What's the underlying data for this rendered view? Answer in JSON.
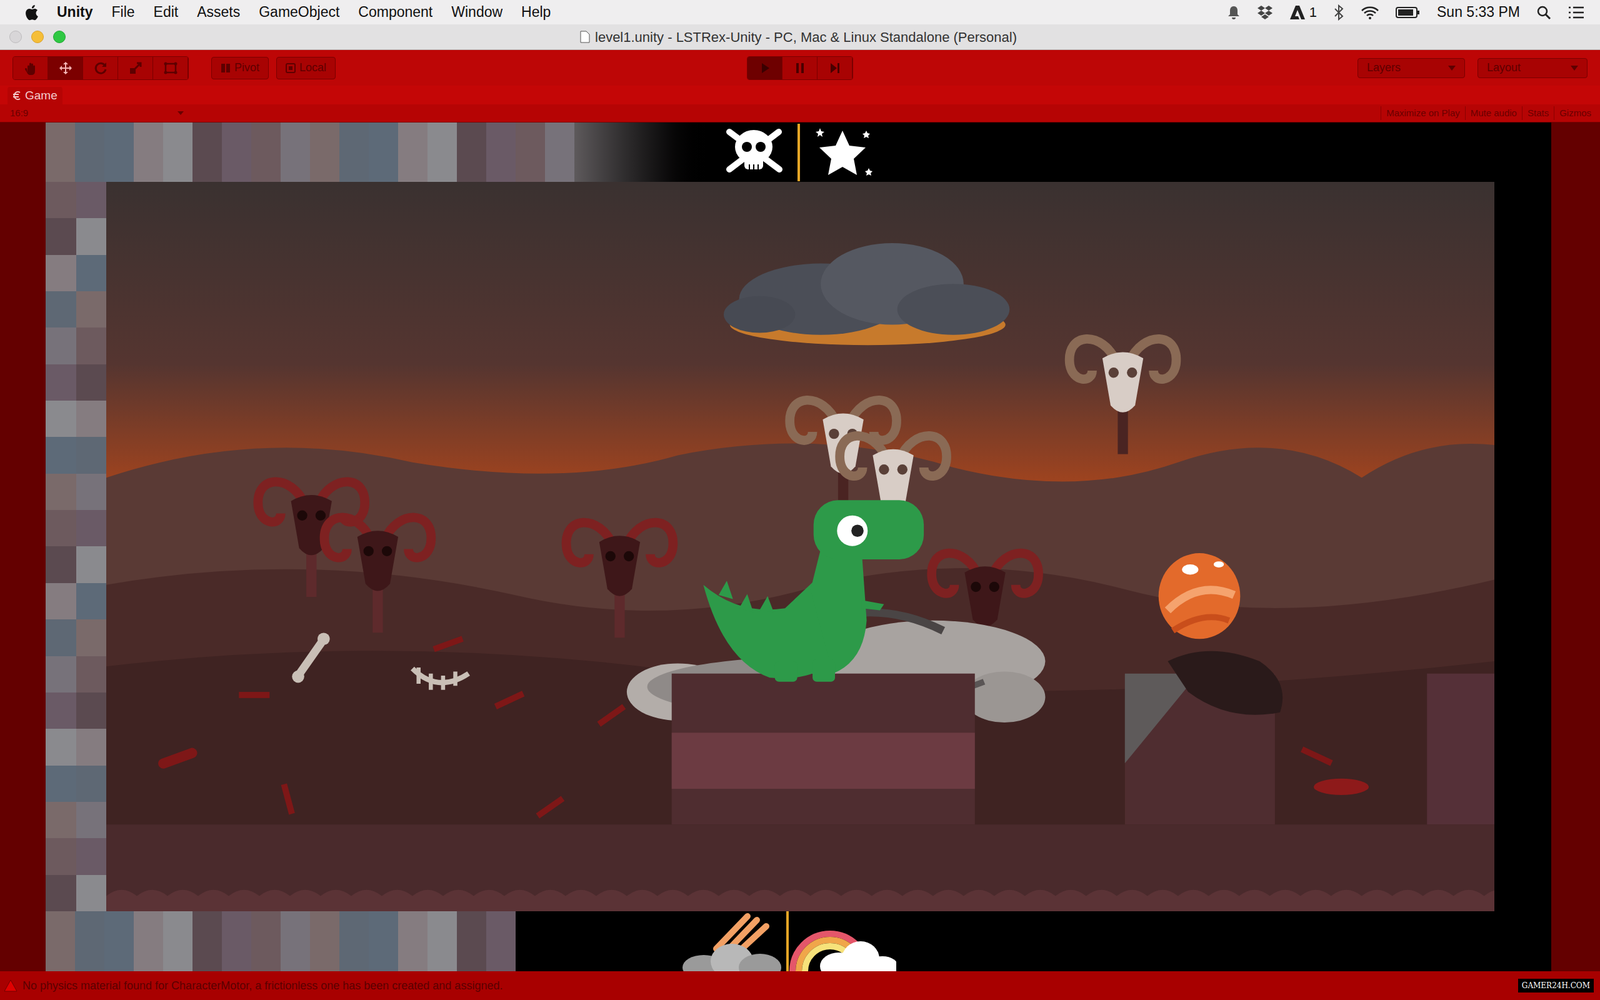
{
  "menu_bar": {
    "items": [
      "Unity",
      "File",
      "Edit",
      "Assets",
      "GameObject",
      "Component",
      "Window",
      "Help"
    ],
    "adobe_badge": "1",
    "clock": "Sun 5:33 PM"
  },
  "window": {
    "title": "level1.unity - LSTRex-Unity - PC, Mac & Linux Standalone (Personal)"
  },
  "toolbar": {
    "tools": [
      {
        "kind": "hand",
        "selected": false
      },
      {
        "kind": "move",
        "selected": true
      },
      {
        "kind": "rotate",
        "selected": false
      },
      {
        "kind": "scale",
        "selected": false
      },
      {
        "kind": "rect",
        "selected": false
      }
    ],
    "pivot": "Pivot",
    "local": "Local",
    "playback": [
      {
        "kind": "play",
        "selected": true
      },
      {
        "kind": "pause",
        "selected": false
      },
      {
        "kind": "step",
        "selected": false
      }
    ],
    "layers": "Layers",
    "layout": "Layout"
  },
  "game_view": {
    "tab": "Game",
    "aspect": "16:9",
    "options": [
      "Maximize on Play",
      "Mute audio",
      "Stats",
      "Gizmos"
    ]
  },
  "status_bar": {
    "message": "No physics material found for CharacterMotor, a frictionless one has been created and assigned.",
    "watermark": "GAMER24H.COM"
  }
}
